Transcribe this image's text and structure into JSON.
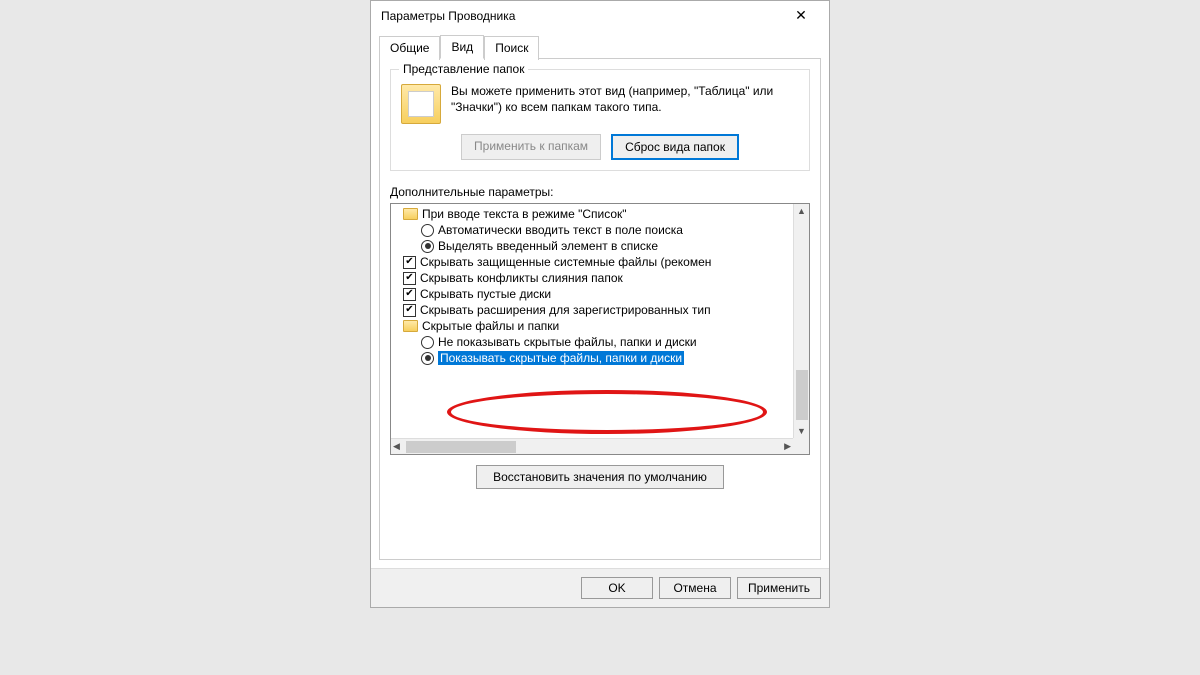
{
  "window": {
    "title": "Параметры Проводника"
  },
  "tabs": {
    "general": "Общие",
    "view": "Вид",
    "search": "Поиск"
  },
  "folderViews": {
    "groupTitle": "Представление папок",
    "description": "Вы можете применить этот вид (например, \"Таблица\" или \"Значки\") ко всем папкам такого типа.",
    "applyBtn": "Применить к папкам",
    "resetBtn": "Сброс вида папок"
  },
  "advanced": {
    "label": "Дополнительные параметры:",
    "items": [
      {
        "type": "folder",
        "level": "top",
        "label": "При вводе текста в режиме \"Список\""
      },
      {
        "type": "radio",
        "level": "child",
        "checked": false,
        "label": "Автоматически вводить текст в поле поиска"
      },
      {
        "type": "radio",
        "level": "child",
        "checked": true,
        "label": "Выделять введенный элемент в списке"
      },
      {
        "type": "check",
        "level": "top",
        "checked": true,
        "label": "Скрывать защищенные системные файлы (рекомен"
      },
      {
        "type": "check",
        "level": "top",
        "checked": true,
        "label": "Скрывать конфликты слияния папок"
      },
      {
        "type": "check",
        "level": "top",
        "checked": true,
        "label": "Скрывать пустые диски"
      },
      {
        "type": "check",
        "level": "top",
        "checked": true,
        "label": "Скрывать расширения для зарегистрированных тип"
      },
      {
        "type": "folder",
        "level": "top",
        "label": "Скрытые файлы и папки"
      },
      {
        "type": "radio",
        "level": "child",
        "checked": false,
        "label": "Не показывать скрытые файлы, папки и диски"
      },
      {
        "type": "radio",
        "level": "child",
        "checked": true,
        "selected": true,
        "label": "Показывать скрытые файлы, папки и диски"
      }
    ],
    "restoreDefaults": "Восстановить значения по умолчанию"
  },
  "dialogButtons": {
    "ok": "OK",
    "cancel": "Отмена",
    "apply": "Применить"
  }
}
